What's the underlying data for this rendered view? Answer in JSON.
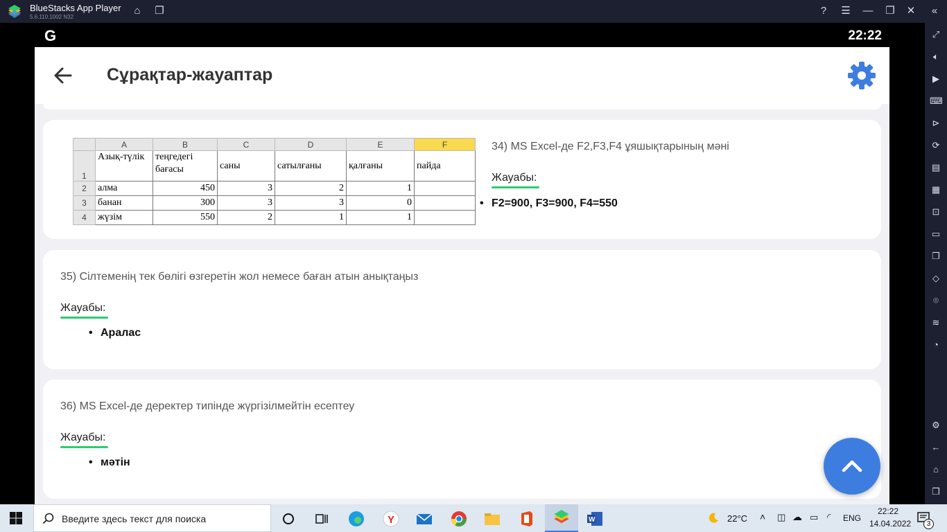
{
  "titlebar": {
    "app_name": "BlueStacks App Player",
    "version": "5.6.110.1002 N32"
  },
  "statusbar": {
    "logo": "G",
    "time": "22:22"
  },
  "header": {
    "title": "Сұрақтар-жауаптар"
  },
  "cards": [
    {
      "question": "34) MS Excel-де F2,F3,F4 ұяшықтарының мәні",
      "answer_label": "Жауабы:",
      "answer": "F2=900, F3=900, F4=550",
      "excel": {
        "columns": [
          "A",
          "B",
          "C",
          "D",
          "E",
          "F"
        ],
        "header_row": [
          "Азық-түлік",
          "теңгедегі бағасы",
          "саны",
          "сатылғаны",
          "қалғаны",
          "пайда"
        ],
        "rows": [
          {
            "n": "2",
            "cells": [
              "алма",
              "450",
              "3",
              "2",
              "1",
              ""
            ]
          },
          {
            "n": "3",
            "cells": [
              "банан",
              "300",
              "3",
              "3",
              "0",
              ""
            ]
          },
          {
            "n": "4",
            "cells": [
              "жүзім",
              "550",
              "2",
              "1",
              "1",
              ""
            ]
          }
        ]
      }
    },
    {
      "question": "35) Сілтеменің тек бөлігі өзгеретін жол немесе баған атын анықтаңыз",
      "answer_label": "Жауабы:",
      "answer": "Аралас"
    },
    {
      "question": "36) MS Excel-де деректер типінде жүргізілмейтін есептеу",
      "answer_label": "Жауабы:",
      "answer": "мәтін"
    }
  ],
  "taskbar": {
    "search_placeholder": "Введите здесь текст для поиска",
    "weather": "22°C",
    "lang": "ENG",
    "time": "22:22",
    "date": "14.04.2022",
    "notifications": "3"
  },
  "colors": {
    "accent": "#3e7de0",
    "answer_underline": "#2ecc71",
    "excel_selected_col": "#f9d94f"
  }
}
